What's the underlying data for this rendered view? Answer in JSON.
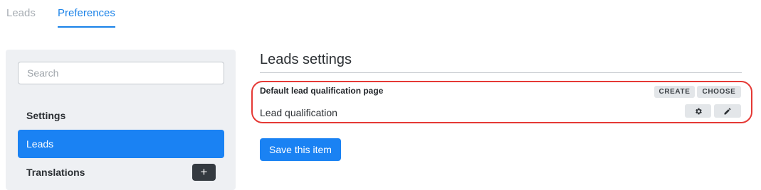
{
  "tabs": [
    {
      "label": "Leads",
      "active": false
    },
    {
      "label": "Preferences",
      "active": true
    }
  ],
  "sidebar": {
    "search_placeholder": "Search",
    "heading": "Settings",
    "active_item": "Leads",
    "translations_label": "Translations",
    "add_symbol": "+"
  },
  "main": {
    "title": "Leads settings",
    "field_label": "Default lead qualification page",
    "create_label": "CREATE",
    "choose_label": "CHOOSE",
    "field_value": "Lead qualification",
    "gear_icon": "gear-icon",
    "edit_icon": "pencil-icon",
    "save_label": "Save this item"
  },
  "colors": {
    "accent": "#1a82f3",
    "highlight": "#e53935",
    "sidebar_bg": "#eef0f3"
  }
}
